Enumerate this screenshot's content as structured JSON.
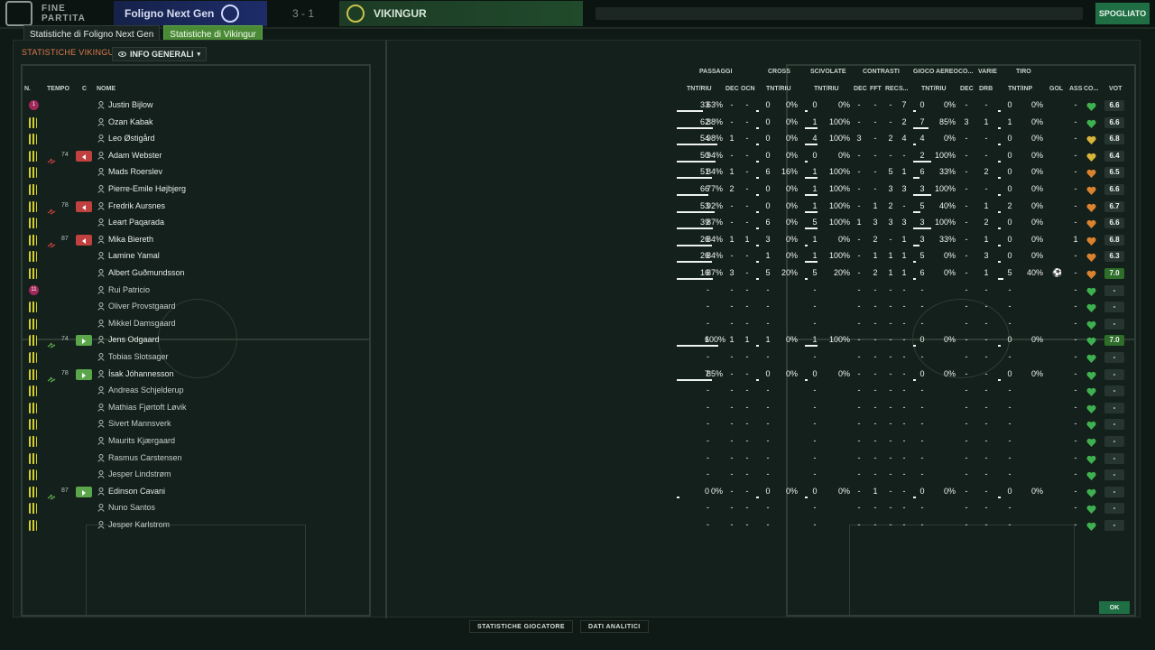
{
  "topbar": {
    "phase": "FINE PARTITA",
    "home_team": "Foligno Next Gen",
    "score": "3 - 1",
    "away_team": "VIKINGUR",
    "skip_label": "SPOGLIATO"
  },
  "tabs": [
    {
      "label": "Statistiche di Foligno Next Gen",
      "active": false
    },
    {
      "label": "Statistiche di Vikingur",
      "active": true
    }
  ],
  "section": {
    "title": "STATISTICHE VIKINGUR",
    "dropdown": "INFO GENERALI"
  },
  "columns": {
    "n": "N.",
    "tempo": "TEMPO",
    "c": "C",
    "nome": "NOME",
    "groups": {
      "passaggi": "PASSAGGI",
      "cross": "CROSS",
      "scivolate": "SCIVOLATE",
      "contrasti": "CONTRASTI",
      "gioco_aereo": "GIOCO AEREO",
      "co": "CO...",
      "varie": "VARIE",
      "tiro": "TIRO"
    },
    "sub": {
      "pass": "TNT/RIU",
      "dec": "DEC",
      "ocn": "OCN",
      "cross": "TNT/RIU",
      "sciv": "TNT/RIU",
      "dec2": "DEC",
      "fft": "FFT",
      "rec": "REC",
      "s": "S...",
      "aereo": "TNT/RIU",
      "dec3": "DEC",
      "drb": "DRB",
      "tiro": "TNT/INP",
      "gol": "GOL",
      "ass": "ASS",
      "co": "CO...",
      "vot": "VOT"
    }
  },
  "players": [
    {
      "name": "Justin Bijlow",
      "kit": "gk",
      "gk_num": "1",
      "sub": "",
      "pass_a": "33",
      "pass_p": "63%",
      "pdec": "-",
      "ocn": "-",
      "cross_a": "0",
      "cross_p": "0%",
      "sciv_a": "0",
      "sciv_p": "0%",
      "cdec": "-",
      "fft": "-",
      "rec": "-",
      "s": "7",
      "aer_a": "0",
      "aer_p": "0%",
      "adec": "-",
      "drb": "-",
      "tiro_a": "0",
      "tiro_p": "0%",
      "gol": "",
      "ass": "-",
      "vot": "6.6"
    },
    {
      "name": "Ozan Kabak",
      "kit": "out",
      "sub": "",
      "pass_a": "62",
      "pass_p": "88%",
      "pdec": "-",
      "ocn": "-",
      "cross_a": "0",
      "cross_p": "0%",
      "sciv_a": "1",
      "sciv_p": "100%",
      "cdec": "-",
      "fft": "-",
      "rec": "-",
      "s": "2",
      "aer_a": "7",
      "aer_p": "85%",
      "adec": "3",
      "drb": "1",
      "tiro_a": "1",
      "tiro_p": "0%",
      "gol": "",
      "ass": "-",
      "vot": "6.6"
    },
    {
      "name": "Leo Østigård",
      "kit": "out",
      "sub": "",
      "pass_a": "54",
      "pass_p": "98%",
      "pdec": "1",
      "ocn": "-",
      "cross_a": "0",
      "cross_p": "0%",
      "sciv_a": "4",
      "sciv_p": "100%",
      "cdec": "3",
      "fft": "-",
      "rec": "2",
      "s": "4",
      "aer_a": "4",
      "aer_p": "0%",
      "adec": "-",
      "drb": "-",
      "tiro_a": "0",
      "tiro_p": "0%",
      "gol": "",
      "ass": "-",
      "vot": "6.8"
    },
    {
      "name": "Adam Webster",
      "kit": "out",
      "sub": "off",
      "sub_min": "74",
      "pass_a": "50",
      "pass_p": "94%",
      "pdec": "-",
      "ocn": "-",
      "cross_a": "0",
      "cross_p": "0%",
      "sciv_a": "0",
      "sciv_p": "0%",
      "cdec": "-",
      "fft": "-",
      "rec": "-",
      "s": "-",
      "aer_a": "2",
      "aer_p": "100%",
      "adec": "-",
      "drb": "-",
      "tiro_a": "0",
      "tiro_p": "0%",
      "gol": "",
      "ass": "-",
      "vot": "6.4"
    },
    {
      "name": "Mads Roerslev",
      "kit": "out",
      "sub": "",
      "pass_a": "51",
      "pass_p": "84%",
      "pdec": "1",
      "ocn": "-",
      "cross_a": "6",
      "cross_p": "16%",
      "sciv_a": "1",
      "sciv_p": "100%",
      "cdec": "-",
      "fft": "-",
      "rec": "5",
      "s": "1",
      "aer_a": "6",
      "aer_p": "33%",
      "adec": "-",
      "drb": "2",
      "tiro_a": "0",
      "tiro_p": "0%",
      "gol": "",
      "ass": "-",
      "vot": "6.5"
    },
    {
      "name": "Pierre-Emile Højbjerg",
      "kit": "out",
      "sub": "",
      "pass_a": "66",
      "pass_p": "77%",
      "pdec": "2",
      "ocn": "-",
      "cross_a": "0",
      "cross_p": "0%",
      "sciv_a": "1",
      "sciv_p": "100%",
      "cdec": "-",
      "fft": "-",
      "rec": "3",
      "s": "3",
      "aer_a": "3",
      "aer_p": "100%",
      "adec": "-",
      "drb": "-",
      "tiro_a": "0",
      "tiro_p": "0%",
      "gol": "",
      "ass": "-",
      "vot": "6.6"
    },
    {
      "name": "Fredrik Aursnes",
      "kit": "out",
      "sub": "off",
      "sub_min": "78",
      "pass_a": "53",
      "pass_p": "92%",
      "pdec": "-",
      "ocn": "-",
      "cross_a": "0",
      "cross_p": "0%",
      "sciv_a": "1",
      "sciv_p": "100%",
      "cdec": "-",
      "fft": "1",
      "rec": "2",
      "s": "-",
      "aer_a": "5",
      "aer_p": "40%",
      "adec": "-",
      "drb": "1",
      "tiro_a": "2",
      "tiro_p": "0%",
      "gol": "",
      "ass": "-",
      "vot": "6.7"
    },
    {
      "name": "Leart Paqarada",
      "kit": "out",
      "sub": "",
      "pass_a": "39",
      "pass_p": "87%",
      "pdec": "-",
      "ocn": "-",
      "cross_a": "6",
      "cross_p": "0%",
      "sciv_a": "5",
      "sciv_p": "100%",
      "cdec": "1",
      "fft": "3",
      "rec": "3",
      "s": "3",
      "aer_a": "3",
      "aer_p": "100%",
      "adec": "-",
      "drb": "2",
      "tiro_a": "0",
      "tiro_p": "0%",
      "gol": "",
      "ass": "-",
      "vot": "6.6"
    },
    {
      "name": "Mika Biereth",
      "kit": "out",
      "sub": "off",
      "sub_min": "87",
      "pass_a": "26",
      "pass_p": "84%",
      "pdec": "1",
      "ocn": "1",
      "cross_a": "3",
      "cross_p": "0%",
      "sciv_a": "1",
      "sciv_p": "0%",
      "cdec": "-",
      "fft": "2",
      "rec": "-",
      "s": "1",
      "aer_a": "3",
      "aer_p": "33%",
      "adec": "-",
      "drb": "1",
      "tiro_a": "0",
      "tiro_p": "0%",
      "gol": "",
      "ass": "1",
      "vot": "6.8"
    },
    {
      "name": "Lamine Yamal",
      "kit": "out",
      "sub": "",
      "pass_a": "26",
      "pass_p": "84%",
      "pdec": "-",
      "ocn": "-",
      "cross_a": "1",
      "cross_p": "0%",
      "sciv_a": "1",
      "sciv_p": "100%",
      "cdec": "-",
      "fft": "1",
      "rec": "1",
      "s": "1",
      "aer_a": "5",
      "aer_p": "0%",
      "adec": "-",
      "drb": "3",
      "tiro_a": "0",
      "tiro_p": "0%",
      "gol": "",
      "ass": "-",
      "vot": "6.3"
    },
    {
      "name": "Albert Guðmundsson",
      "kit": "out",
      "sub": "",
      "pass_a": "16",
      "pass_p": "87%",
      "pdec": "3",
      "ocn": "-",
      "cross_a": "5",
      "cross_p": "20%",
      "sciv_a": "5",
      "sciv_p": "20%",
      "cdec": "-",
      "fft": "2",
      "rec": "1",
      "s": "1",
      "aer_a": "6",
      "aer_p": "0%",
      "adec": "-",
      "drb": "1",
      "tiro_a": "5",
      "tiro_p": "40%",
      "gol": "⚽",
      "ass": "-",
      "vot": "7.0"
    },
    {
      "name": "Rui Patricio",
      "kit": "gk",
      "gk_num": "11",
      "sub": "",
      "pass_a": "-",
      "pass_p": "",
      "pdec": "-",
      "ocn": "-",
      "cross_a": "-",
      "cross_p": "",
      "sciv_a": "-",
      "sciv_p": "",
      "cdec": "-",
      "fft": "-",
      "rec": "-",
      "s": "-",
      "aer_a": "-",
      "aer_p": "",
      "adec": "-",
      "drb": "-",
      "tiro_a": "-",
      "tiro_p": "",
      "gol": "",
      "ass": "-",
      "vot": "-"
    },
    {
      "name": "Oliver Provstgaard",
      "kit": "out",
      "sub": "",
      "pass_a": "-",
      "pass_p": "",
      "pdec": "-",
      "ocn": "-",
      "cross_a": "-",
      "cross_p": "",
      "sciv_a": "-",
      "sciv_p": "",
      "cdec": "-",
      "fft": "-",
      "rec": "-",
      "s": "-",
      "aer_a": "-",
      "aer_p": "",
      "adec": "-",
      "drb": "-",
      "tiro_a": "-",
      "tiro_p": "",
      "gol": "",
      "ass": "-",
      "vot": "-"
    },
    {
      "name": "Mikkel Damsgaard",
      "kit": "out",
      "sub": "",
      "pass_a": "-",
      "pass_p": "",
      "pdec": "-",
      "ocn": "-",
      "cross_a": "-",
      "cross_p": "",
      "sciv_a": "-",
      "sciv_p": "",
      "cdec": "-",
      "fft": "-",
      "rec": "-",
      "s": "-",
      "aer_a": "-",
      "aer_p": "",
      "adec": "-",
      "drb": "-",
      "tiro_a": "-",
      "tiro_p": "",
      "gol": "",
      "ass": "-",
      "vot": "-"
    },
    {
      "name": "Jens Odgaard",
      "kit": "out",
      "sub": "on",
      "sub_min": "74",
      "pass_a": "6",
      "pass_p": "100%",
      "pdec": "1",
      "ocn": "1",
      "cross_a": "1",
      "cross_p": "0%",
      "sciv_a": "1",
      "sciv_p": "100%",
      "cdec": "-",
      "fft": "-",
      "rec": "-",
      "s": "-",
      "aer_a": "0",
      "aer_p": "0%",
      "adec": "-",
      "drb": "-",
      "tiro_a": "0",
      "tiro_p": "0%",
      "gol": "",
      "ass": "-",
      "vot": "7.0"
    },
    {
      "name": "Tobias Slotsager",
      "kit": "out",
      "sub": "",
      "pass_a": "-",
      "pass_p": "",
      "pdec": "-",
      "ocn": "-",
      "cross_a": "-",
      "cross_p": "",
      "sciv_a": "-",
      "sciv_p": "",
      "cdec": "-",
      "fft": "-",
      "rec": "-",
      "s": "-",
      "aer_a": "-",
      "aer_p": "",
      "adec": "-",
      "drb": "-",
      "tiro_a": "-",
      "tiro_p": "",
      "gol": "",
      "ass": "-",
      "vot": "-"
    },
    {
      "name": "Ísak Jóhannesson",
      "kit": "out",
      "sub": "on",
      "sub_min": "78",
      "pass_a": "7",
      "pass_p": "85%",
      "pdec": "-",
      "ocn": "-",
      "cross_a": "0",
      "cross_p": "0%",
      "sciv_a": "0",
      "sciv_p": "0%",
      "cdec": "-",
      "fft": "-",
      "rec": "-",
      "s": "-",
      "aer_a": "0",
      "aer_p": "0%",
      "adec": "-",
      "drb": "-",
      "tiro_a": "0",
      "tiro_p": "0%",
      "gol": "",
      "ass": "-",
      "vot": "-"
    },
    {
      "name": "Andreas Schjelderup",
      "kit": "out",
      "sub": "",
      "pass_a": "-",
      "pass_p": "",
      "pdec": "-",
      "ocn": "-",
      "cross_a": "-",
      "cross_p": "",
      "sciv_a": "-",
      "sciv_p": "",
      "cdec": "-",
      "fft": "-",
      "rec": "-",
      "s": "-",
      "aer_a": "-",
      "aer_p": "",
      "adec": "-",
      "drb": "-",
      "tiro_a": "-",
      "tiro_p": "",
      "gol": "",
      "ass": "-",
      "vot": "-"
    },
    {
      "name": "Mathias Fjørtoft Løvik",
      "kit": "out",
      "sub": "",
      "pass_a": "-",
      "pass_p": "",
      "pdec": "-",
      "ocn": "-",
      "cross_a": "-",
      "cross_p": "",
      "sciv_a": "-",
      "sciv_p": "",
      "cdec": "-",
      "fft": "-",
      "rec": "-",
      "s": "-",
      "aer_a": "-",
      "aer_p": "",
      "adec": "-",
      "drb": "-",
      "tiro_a": "-",
      "tiro_p": "",
      "gol": "",
      "ass": "-",
      "vot": "-"
    },
    {
      "name": "Sivert Mannsverk",
      "kit": "out",
      "sub": "",
      "pass_a": "-",
      "pass_p": "",
      "pdec": "-",
      "ocn": "-",
      "cross_a": "-",
      "cross_p": "",
      "sciv_a": "-",
      "sciv_p": "",
      "cdec": "-",
      "fft": "-",
      "rec": "-",
      "s": "-",
      "aer_a": "-",
      "aer_p": "",
      "adec": "-",
      "drb": "-",
      "tiro_a": "-",
      "tiro_p": "",
      "gol": "",
      "ass": "-",
      "vot": "-"
    },
    {
      "name": "Maurits Kjærgaard",
      "kit": "out",
      "sub": "",
      "pass_a": "-",
      "pass_p": "",
      "pdec": "-",
      "ocn": "-",
      "cross_a": "-",
      "cross_p": "",
      "sciv_a": "-",
      "sciv_p": "",
      "cdec": "-",
      "fft": "-",
      "rec": "-",
      "s": "-",
      "aer_a": "-",
      "aer_p": "",
      "adec": "-",
      "drb": "-",
      "tiro_a": "-",
      "tiro_p": "",
      "gol": "",
      "ass": "-",
      "vot": "-"
    },
    {
      "name": "Rasmus Carstensen",
      "kit": "out",
      "sub": "",
      "pass_a": "-",
      "pass_p": "",
      "pdec": "-",
      "ocn": "-",
      "cross_a": "-",
      "cross_p": "",
      "sciv_a": "-",
      "sciv_p": "",
      "cdec": "-",
      "fft": "-",
      "rec": "-",
      "s": "-",
      "aer_a": "-",
      "aer_p": "",
      "adec": "-",
      "drb": "-",
      "tiro_a": "-",
      "tiro_p": "",
      "gol": "",
      "ass": "-",
      "vot": "-"
    },
    {
      "name": "Jesper Lindstrøm",
      "kit": "out",
      "sub": "",
      "pass_a": "-",
      "pass_p": "",
      "pdec": "-",
      "ocn": "-",
      "cross_a": "-",
      "cross_p": "",
      "sciv_a": "-",
      "sciv_p": "",
      "cdec": "-",
      "fft": "-",
      "rec": "-",
      "s": "-",
      "aer_a": "-",
      "aer_p": "",
      "adec": "-",
      "drb": "-",
      "tiro_a": "-",
      "tiro_p": "",
      "gol": "",
      "ass": "-",
      "vot": "-"
    },
    {
      "name": "Edinson Cavani",
      "kit": "out",
      "sub": "on",
      "sub_min": "87",
      "pass_a": "0",
      "pass_p": "0%",
      "pdec": "-",
      "ocn": "-",
      "cross_a": "0",
      "cross_p": "0%",
      "sciv_a": "0",
      "sciv_p": "0%",
      "cdec": "-",
      "fft": "1",
      "rec": "-",
      "s": "-",
      "aer_a": "0",
      "aer_p": "0%",
      "adec": "-",
      "drb": "-",
      "tiro_a": "0",
      "tiro_p": "0%",
      "gol": "",
      "ass": "-",
      "vot": "-"
    },
    {
      "name": "Nuno Santos",
      "kit": "out",
      "sub": "",
      "pass_a": "-",
      "pass_p": "",
      "pdec": "-",
      "ocn": "-",
      "cross_a": "-",
      "cross_p": "",
      "sciv_a": "-",
      "sciv_p": "",
      "cdec": "-",
      "fft": "-",
      "rec": "-",
      "s": "-",
      "aer_a": "-",
      "aer_p": "",
      "adec": "-",
      "drb": "-",
      "tiro_a": "-",
      "tiro_p": "",
      "gol": "",
      "ass": "-",
      "vot": "-"
    },
    {
      "name": "Jesper Karlstrom",
      "kit": "out",
      "sub": "",
      "pass_a": "-",
      "pass_p": "",
      "pdec": "-",
      "ocn": "-",
      "cross_a": "-",
      "cross_p": "",
      "sciv_a": "-",
      "sciv_p": "",
      "cdec": "-",
      "fft": "-",
      "rec": "-",
      "s": "-",
      "aer_a": "-",
      "aer_p": "",
      "adec": "-",
      "drb": "-",
      "tiro_a": "-",
      "tiro_p": "",
      "gol": "",
      "ass": "-",
      "vot": "-"
    }
  ],
  "bottom": {
    "player_stats": "STATISTICHE GIOCATORE",
    "analytics": "DATI ANALITICI",
    "ok": "OK"
  },
  "colors": {
    "accent_green": "#4a8a36",
    "heart": "#3fb04f",
    "heart_gold": "#d8b43a",
    "heart_orange": "#d9822f",
    "sub_off": "#c0413f",
    "sub_on": "#5ba64b"
  }
}
